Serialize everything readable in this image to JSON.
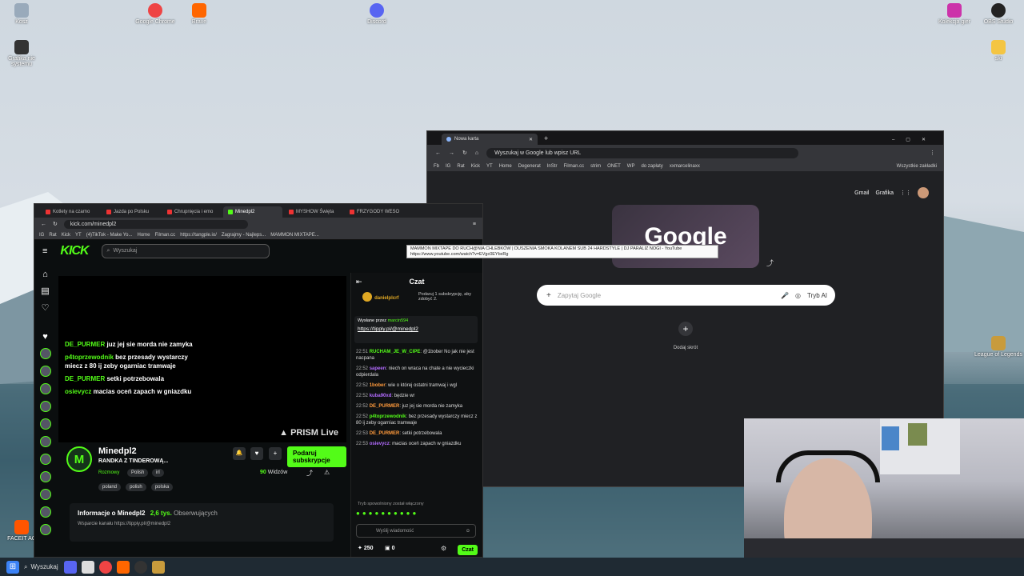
{
  "desktop": {
    "icons": [
      {
        "label": "Kosz",
        "name": "recycle-bin-icon",
        "color": "#9ab"
      },
      {
        "label": "Google Chrome",
        "name": "chrome-icon",
        "color": "#e44"
      },
      {
        "label": "Brave",
        "name": "brave-icon",
        "color": "#f60"
      },
      {
        "label": "Discord",
        "name": "discord-icon",
        "color": "#5865f2"
      },
      {
        "label": "Kolekcja gier",
        "name": "game-collection-icon",
        "color": "#c3a"
      },
      {
        "label": "OBS Studio",
        "name": "obs-icon",
        "color": "#222"
      },
      {
        "label": "Grafika nie systemu",
        "name": "shortcut-icon",
        "color": "#333"
      },
      {
        "label": "ski",
        "name": "folder-icon",
        "color": "#f4c542"
      },
      {
        "label": "FACEIT AC",
        "name": "faceit-icon",
        "color": "#f50"
      },
      {
        "label": "League of Legends",
        "name": "lol-icon",
        "color": "#c89b3c"
      }
    ]
  },
  "taskbar": {
    "search_label": "Wyszukaj"
  },
  "kick_browser": {
    "tabs": [
      "Kotlety na czarno",
      "Jazda po Polsku",
      "Chrupnięcia i emo",
      "Minedpl2",
      "MYSHOW Święta",
      "FRZYGODY WESO"
    ],
    "url": "kick.com/minedpl2",
    "bookmarks": [
      "IG",
      "Rat",
      "Kick",
      "YT",
      "(4)TikTok - Make Yo...",
      "Home",
      "Filman.cc",
      "https://tangple.io/",
      "Zagrajmy - Najleps...",
      "MAMMON MIXTAPE..."
    ],
    "search_placeholder": "Wyszukaj",
    "logo": "KICK"
  },
  "video_overlay": {
    "messages": [
      {
        "user": "DE_PURMER",
        "text": "juz jej sie morda nie zamyka"
      },
      {
        "user": "p4toprzewodnik",
        "text": "bez przesady wystarczy miecz z 80 ij zeby ogarniac tramwaje"
      },
      {
        "user": "DE_PURMER",
        "text": "setki potrzebowala"
      },
      {
        "user": "osievycz",
        "text": "macias oceń zapach w gniazdku"
      }
    ],
    "prism_label": "PRISM Live"
  },
  "stream": {
    "channel": "Minedpl2",
    "title": "RANDKA Z TINDEROWĄ...",
    "category": "Rozmowy",
    "tags_row1": [
      "Polish",
      "irl"
    ],
    "tags_row2": [
      "poland",
      "polish",
      "polska"
    ],
    "subscribe_label": "Podaruj subskrypcje",
    "viewers_count": "90",
    "viewers_label": "Widzów",
    "about_title": "Informacje o Minedpl2",
    "followers_count": "2,6 tys.",
    "followers_label": "Obserwujących",
    "about_desc": "Wsparcie kanału https://tippiy.pl/@minedpl2"
  },
  "chat": {
    "title": "Czat",
    "top_user": "danielplcrf",
    "top_info": "Podaruj 1 subskrypcję, aby zdobyć 2.",
    "pinned_by": "Wysłane przez",
    "pinned_user": "marcin594",
    "pinned_link": "https://tipply.pl/@minedpl2",
    "messages": [
      {
        "time": "22:51",
        "user": "RUCHAM_JE_W_CIPE",
        "color": "#53fc18",
        "text": "@1bober No jak nie jest nacpana"
      },
      {
        "time": "22:52",
        "user": "sapeen",
        "color": "#b36bff",
        "text": "niech on wraca na chate a nie wycieczki odpierdala"
      },
      {
        "time": "22:52",
        "user": "1bober",
        "color": "#ff9a3c",
        "text": "wie o której ostatni tramwaj i wgl"
      },
      {
        "time": "22:52",
        "user": "kuba90xd",
        "color": "#b36bff",
        "text": "będzie wr"
      },
      {
        "time": "22:52",
        "user": "DE_PURMER",
        "color": "#ff9a3c",
        "text": "juz jej sie morda nie zamyka"
      },
      {
        "time": "22:52",
        "user": "p4toprzewodnik",
        "color": "#53fc18",
        "text": "bez przesady wystarczy miecz z 80 ij zeby ogarniac tramwaje"
      },
      {
        "time": "22:53",
        "user": "DE_PURMER",
        "color": "#ff9a3c",
        "text": "setki potrzebowala"
      },
      {
        "time": "22:53",
        "user": "osievycz",
        "color": "#b36bff",
        "text": "macias oceń zapach w gniazdku"
      }
    ],
    "slow_mode": "Tryb spowolniony został włączony",
    "input_placeholder": "Wyślij wiadomość",
    "points": "250",
    "gifts": "0",
    "send_label": "Czat"
  },
  "chrome_browser": {
    "tab_title": "Nowa karta",
    "omnibox_placeholder": "Wyszukaj w Google lub wpisz URL",
    "bookmarks": [
      "Fb",
      "IG",
      "Rat",
      "Kick",
      "YT",
      "Home",
      "Degenerat",
      "InStr",
      "Filman.cc",
      "strim",
      "ONET",
      "WP",
      "do zapłaty",
      "xxmarcelinaxx"
    ],
    "all_bookmarks": "Wszystkie zakładki",
    "top_links": [
      "Gmail",
      "Grafika"
    ],
    "doodle_text": "Google",
    "search_placeholder": "Zapytaj Google",
    "ai_mode": "Tryb AI",
    "add_shortcut": "Dodaj skrót",
    "tooltip_title": "MAMMON MIXTAPE DO RUCH@NIA CHLEBKÓW | DUSZENIA SMOKA KOLANEM SUB 24 HARDSTYLE | DJ PARALIZ NOGI - YouTube",
    "tooltip_url": "https://www.youtube.com/watch?v=EVgc0EYbxRg"
  }
}
